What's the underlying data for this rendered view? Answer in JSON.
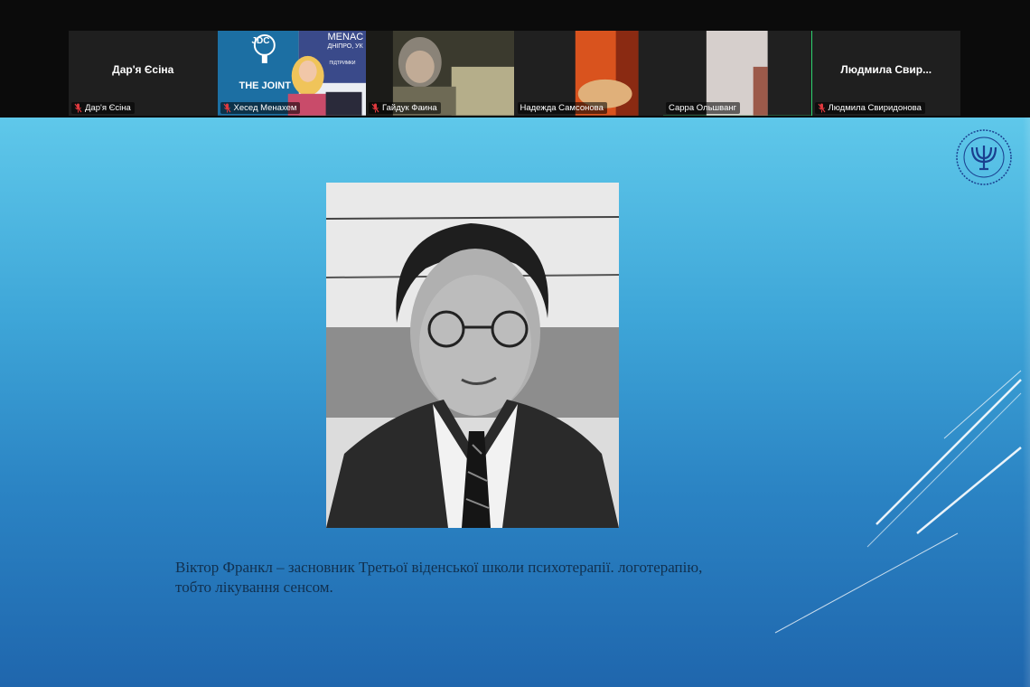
{
  "participants": [
    {
      "display_name": "Дар'я Єсіна",
      "label": "Дар'я Єсіна",
      "muted": true,
      "video": false
    },
    {
      "display_name": "",
      "label": "Хесед Менахем",
      "muted": true,
      "video": true,
      "overlay_texts": {
        "logo": "JDC",
        "subtitle": "THE JOINT",
        "banner": "MENAC",
        "banner_sub": "ДНІПРО, УК",
        "banner_small": "ПІДТРИМКИ"
      }
    },
    {
      "display_name": "",
      "label": "Гайдук Фаина",
      "muted": true,
      "video": true
    },
    {
      "display_name": "",
      "label": "Надежда Самсонова",
      "muted": false,
      "video": true
    },
    {
      "display_name": "",
      "label": "Сарра Ольшванг",
      "muted": false,
      "video": true,
      "active_speaker": true
    },
    {
      "display_name": "Людмила  Свир...",
      "label": "Людмила Свиридонова",
      "muted": true,
      "video": false
    }
  ],
  "slide": {
    "caption_line1": "Віктор Франкл  – засновник  Третьої віденської школи психотерапії.  логотерапію,",
    "caption_line2": "тобто лікування  сенсом.",
    "portrait_subject": "Viktor Frankl photo"
  },
  "colors": {
    "active_speaker_border": "#2ed36f",
    "muted_icon": "#e0393e",
    "slide_text": "#11304f"
  },
  "icons": {
    "mic": "mic-muted-icon",
    "logo": "menorah-seal-icon"
  }
}
